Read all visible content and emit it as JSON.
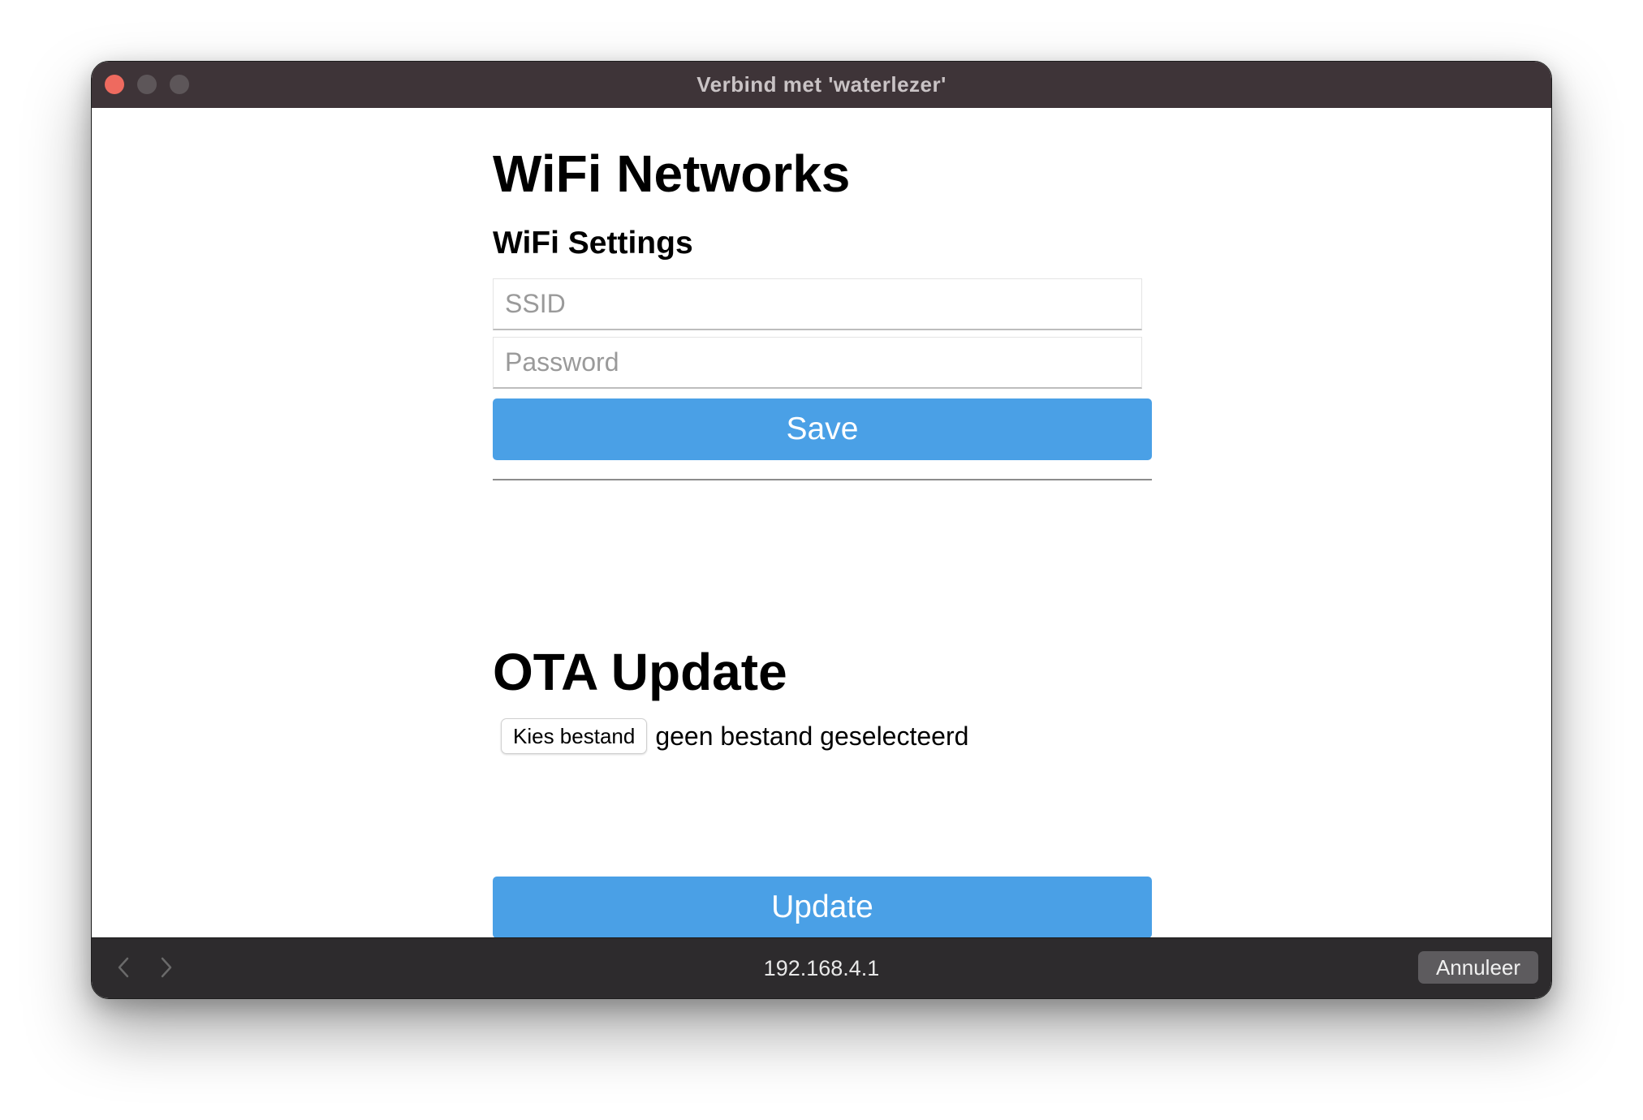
{
  "window": {
    "title": "Verbind met 'waterlezer'"
  },
  "wifi": {
    "heading": "WiFi Networks",
    "subheading": "WiFi Settings",
    "ssid_placeholder": "SSID",
    "ssid_value": "",
    "password_placeholder": "Password",
    "password_value": "",
    "save_label": "Save"
  },
  "ota": {
    "heading": "OTA Update",
    "choose_file_label": "Kies bestand",
    "file_status": "geen bestand geselecteerd",
    "update_label": "Update"
  },
  "bottombar": {
    "back_icon": "chevron-left-icon",
    "forward_icon": "chevron-right-icon",
    "url": "192.168.4.1",
    "cancel_label": "Annuleer"
  },
  "colors": {
    "primary_button": "#4aa0e6",
    "titlebar": "#3e3438",
    "bottombar": "#2d2b2d",
    "close_dot": "#ee6a5f"
  }
}
